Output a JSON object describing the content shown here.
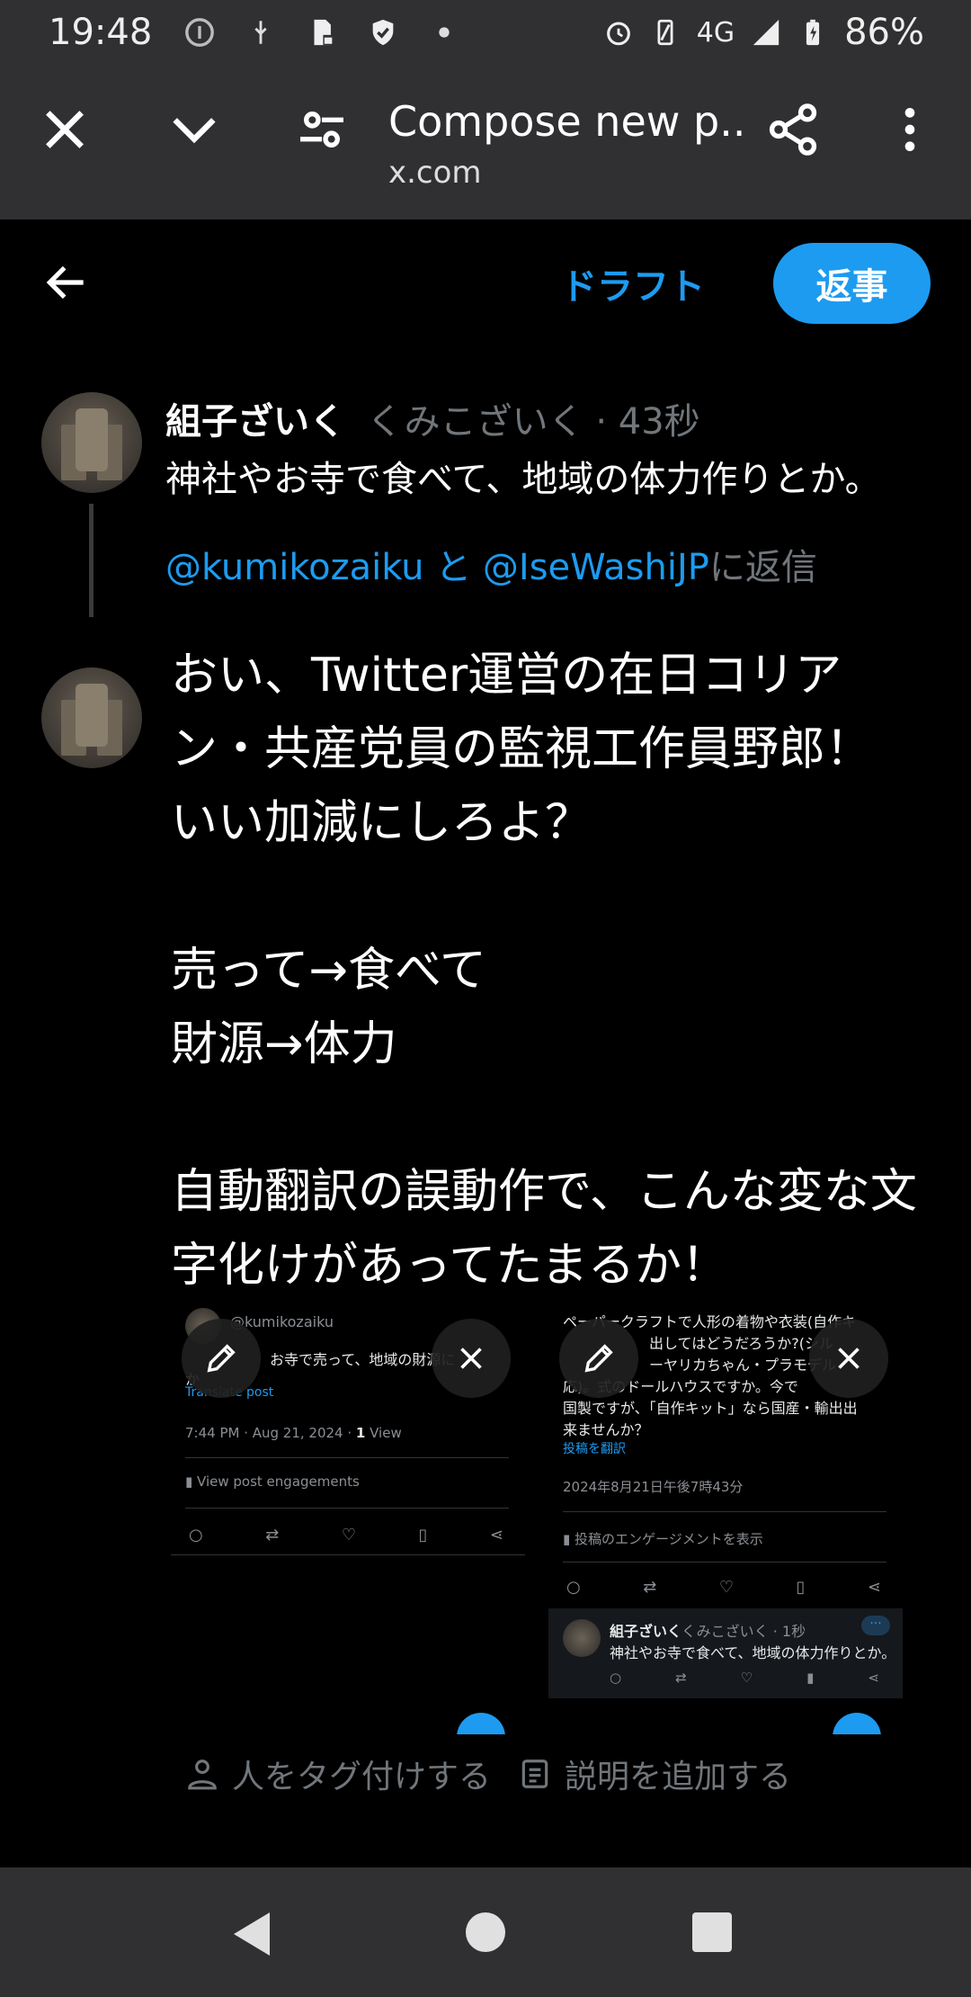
{
  "status_bar": {
    "time": "19:48",
    "network": "4G",
    "battery": "86%"
  },
  "browser": {
    "page_title": "Compose new p...",
    "url": "x.com"
  },
  "compose_header": {
    "draft_label": "ドラフト",
    "reply_label": "返事"
  },
  "parent_tweet": {
    "name": "組子ざいく",
    "handle_time": "くみこざいく · 43秒",
    "text": "神社やお寺で食べて、地域の体力作りとか。"
  },
  "replying_to": {
    "mention1": "@kumikozaiku",
    "and": " と ",
    "mention2": "@IseWashiJP",
    "suffix": "に返信"
  },
  "compose": {
    "text": "おい、Twitter運営の在日コリアン・共産党員の監視工作員野郎！　いい加減にしろよ？\n\n売って→食べて\n財源→体力\n\n自動翻訳の誤動作で、こんな変な文字化けがあってたまるか！"
  },
  "media1": {
    "handle": "@kumikozaiku",
    "text": "お寺で売って、地域の財源に",
    "text2": "か",
    "translate": "Translate post",
    "meta": "7:44 PM · Aug 21, 2024 · ",
    "views_count": "1",
    "views_label": " View",
    "engagements": "View post engagements"
  },
  "media2": {
    "line1": "ペーパークラフトで人形の着物や衣装(自作キ",
    "line2": "出してはどうだろうか?(シル",
    "line3": "ーヤリカちゃん・プラモデル",
    "line4": "応)。式のドールハウスですか。今で",
    "line5": "国製ですが、「自作キット」なら国産・輸出出",
    "line6": "来ませんか？",
    "translate": "投稿を翻訳",
    "meta": "2024年8月21日午後7時43分",
    "engagements": "投稿のエンゲージメントを表示",
    "reply_name": "組子ざいく",
    "reply_handle": "くみこざいく · 1秒",
    "reply_text": "神社やお寺で食べて、地域の体力作りとか。"
  },
  "actions": {
    "tag_people": "人をタグ付けする",
    "add_description": "説明を追加する"
  },
  "colors": {
    "accent": "#1d9bf0",
    "chrome": "#303033",
    "muted": "#71767b"
  }
}
